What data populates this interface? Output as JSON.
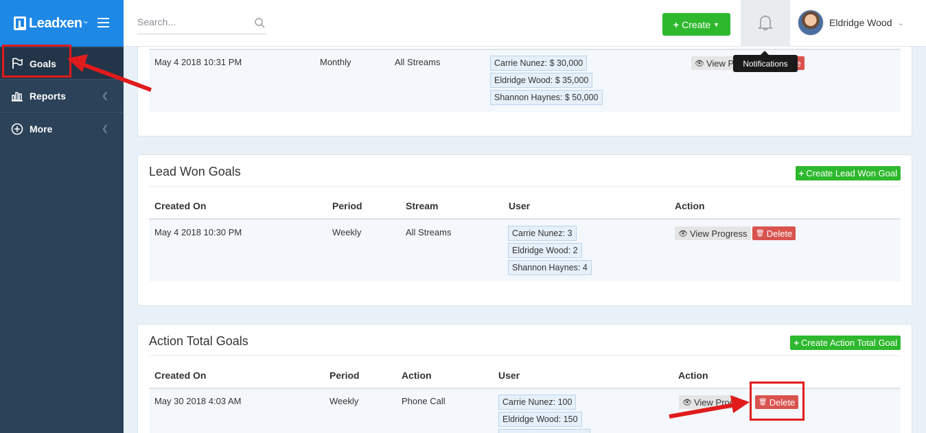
{
  "brand": {
    "name": "Leadxen",
    "tm": "™"
  },
  "sidebar": {
    "items": [
      {
        "label": "Goals"
      },
      {
        "label": "Reports"
      },
      {
        "label": "More"
      }
    ]
  },
  "topbar": {
    "search_placeholder": "Search...",
    "create_label": "Create",
    "user_name": "Eldridge Wood",
    "tooltip": "Notifications"
  },
  "top_card": {
    "row": {
      "created_on": "May 4 2018 10:31 PM",
      "period": "Monthly",
      "stream": "All Streams",
      "users": [
        "Carrie Nunez: $ 30,000",
        "Eldridge Wood: $ 35,000",
        "Shannon Haynes: $ 50,000"
      ],
      "view_label": "View Pro",
      "delete_label": "te"
    }
  },
  "lead_won": {
    "title": "Lead Won Goals",
    "create_label": "Create Lead Won Goal",
    "headers": [
      "Created On",
      "Period",
      "Stream",
      "User",
      "Action"
    ],
    "row": {
      "created_on": "May 4 2018 10:30 PM",
      "period": "Weekly",
      "stream": "All Streams",
      "users": [
        "Carrie Nunez: 3",
        "Eldridge Wood: 2",
        "Shannon Haynes: 4"
      ],
      "view_label": "View Progress",
      "delete_label": "Delete"
    }
  },
  "action_total": {
    "title": "Action Total Goals",
    "create_label": "Create Action Total Goal",
    "headers": [
      "Created On",
      "Period",
      "Action",
      "User",
      "Action"
    ],
    "row": {
      "created_on": "May 30 2018 4:03 AM",
      "period": "Weekly",
      "action": "Phone Call",
      "users": [
        "Carrie Nunez: 100",
        "Eldridge Wood: 150"
      ],
      "view_label": "View Prog",
      "delete_label": "Delete"
    }
  },
  "colors": {
    "primary": "#1e88e5",
    "sidebar": "#2c4259",
    "success": "#2eb82e",
    "danger": "#d9534f",
    "annotation": "#e01b1b"
  }
}
